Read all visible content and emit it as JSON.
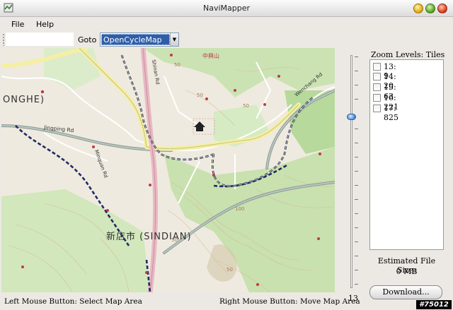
{
  "window": {
    "title": "NaviMapper"
  },
  "menu": {
    "file": "File",
    "help": "Help"
  },
  "toolbar": {
    "search_value": "",
    "goto_label": "Goto",
    "map_source": "OpenCycleMap"
  },
  "map": {
    "labels": {
      "onghe": "ONGHE)",
      "jingping": "Jingping Rd",
      "sindian": "新店市 (SINDIAN)",
      "shinan": "Shinan Rd",
      "zhongshan": "中興山",
      "minquan": "Minquan Rd",
      "n50a": "50",
      "n50b": "50",
      "n50c": "50",
      "n50d": "50",
      "n50e": "50",
      "n100": "100",
      "wengchang": "Wenchang Rd"
    }
  },
  "zoom": {
    "current": "13",
    "slider_fraction": 0.25
  },
  "levels": {
    "title": "Zoom Levels: Tiles",
    "items": [
      {
        "label": "13: 9"
      },
      {
        "label": "14: 20"
      },
      {
        "label": "15: 63"
      },
      {
        "label": "16: 221"
      },
      {
        "label": "17: 825"
      }
    ]
  },
  "estimate": {
    "label": "Estimated File Size:",
    "value": "0 MB"
  },
  "download": {
    "label": "Download..."
  },
  "status": {
    "left": "Left Mouse Button: Select Map Area",
    "right": "Right Mouse Button: Move Map Area"
  },
  "watermark": "#75012",
  "colors": {
    "accent": "#2f5ea8",
    "map_bg": "#efeadf",
    "forest": "#b9dba0",
    "road": "#f5f0a8"
  }
}
